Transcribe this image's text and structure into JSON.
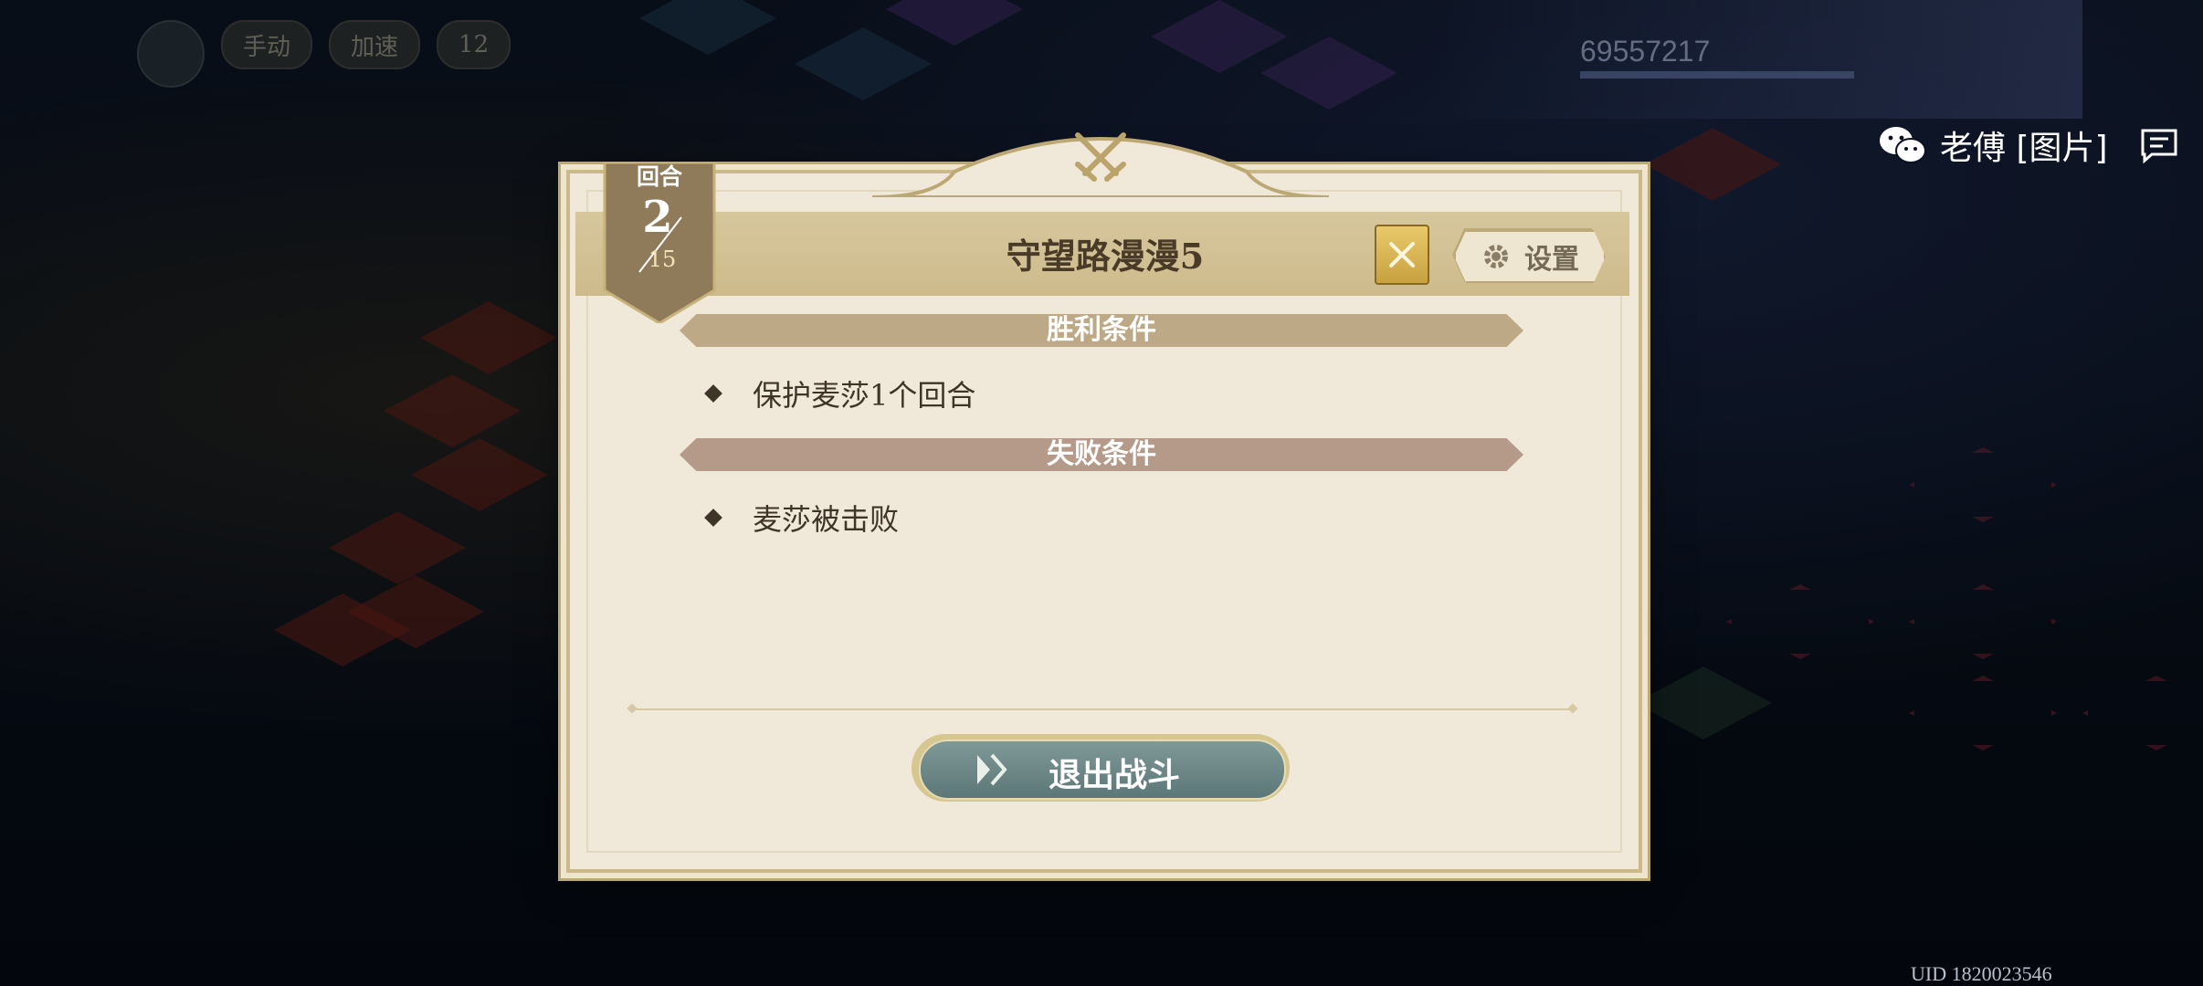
{
  "background": {
    "hud_buttons": [
      "手动",
      "加速",
      "12"
    ],
    "player_score": "69557217"
  },
  "share": {
    "label": "老傅 [图片]"
  },
  "dialog": {
    "title": "守望路漫漫5",
    "turn": {
      "label": "回合",
      "current": "2",
      "max": "15"
    },
    "settings_label": "设置",
    "victory": {
      "header": "胜利条件",
      "items": [
        "保护麦莎1个回合"
      ]
    },
    "defeat": {
      "header": "失败条件",
      "items": [
        "麦莎被击败"
      ]
    },
    "exit_label": "退出战斗"
  },
  "uid": "UID 1820023546",
  "colors": {
    "header_band": "#cdbb8c",
    "victory_bar": "#bda985",
    "defeat_bar": "#b59a8a",
    "exit_button": "#5c7777",
    "panel": "#f0e8d9"
  },
  "icons": [
    "crossed-swords-icon",
    "book-icon",
    "gear-icon",
    "double-chevron-icon",
    "wechat-icon",
    "chat-icon"
  ]
}
